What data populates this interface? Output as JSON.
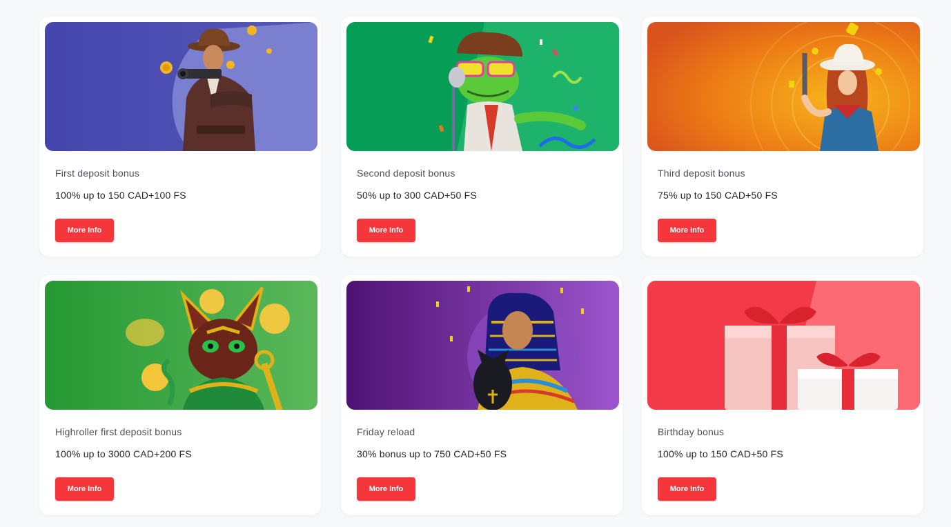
{
  "promotions": {
    "cards": [
      {
        "title": "First deposit bonus",
        "offer": "100% up to 150 CAD+100 FS",
        "button_label": "More Info",
        "art": "cowboy-gunslinger-illustration",
        "bg_color": "#4a4aad"
      },
      {
        "title": "Second deposit bonus",
        "offer": "50% up to 300 CAD+50 FS",
        "button_label": "More Info",
        "art": "party-frog-illustration",
        "bg_color": "#0aa35a"
      },
      {
        "title": "Third deposit bonus",
        "offer": "75% up to 150 CAD+50 FS",
        "button_label": "More Info",
        "art": "cowgirl-gunslinger-illustration",
        "bg_color": "#e8620f"
      },
      {
        "title": "Highroller first deposit bonus",
        "offer": "100% up to 3000 CAD+200 FS",
        "button_label": "More Info",
        "art": "egyptian-cat-illustration",
        "bg_color": "#2a9a3a"
      },
      {
        "title": "Friday reload",
        "offer": "30% bonus up to 750 CAD+50 FS",
        "button_label": "More Info",
        "art": "cleopatra-illustration",
        "bg_color": "#5a1a85"
      },
      {
        "title": "Birthday bonus",
        "offer": "100% up to 150 CAD+50 FS",
        "button_label": "More Info",
        "art": "gift-boxes-illustration",
        "bg_color": "#f23a48"
      }
    ]
  },
  "colors": {
    "button": "#f5363b",
    "page_bg": "#f7f8fa",
    "card_bg": "#ffffff"
  }
}
